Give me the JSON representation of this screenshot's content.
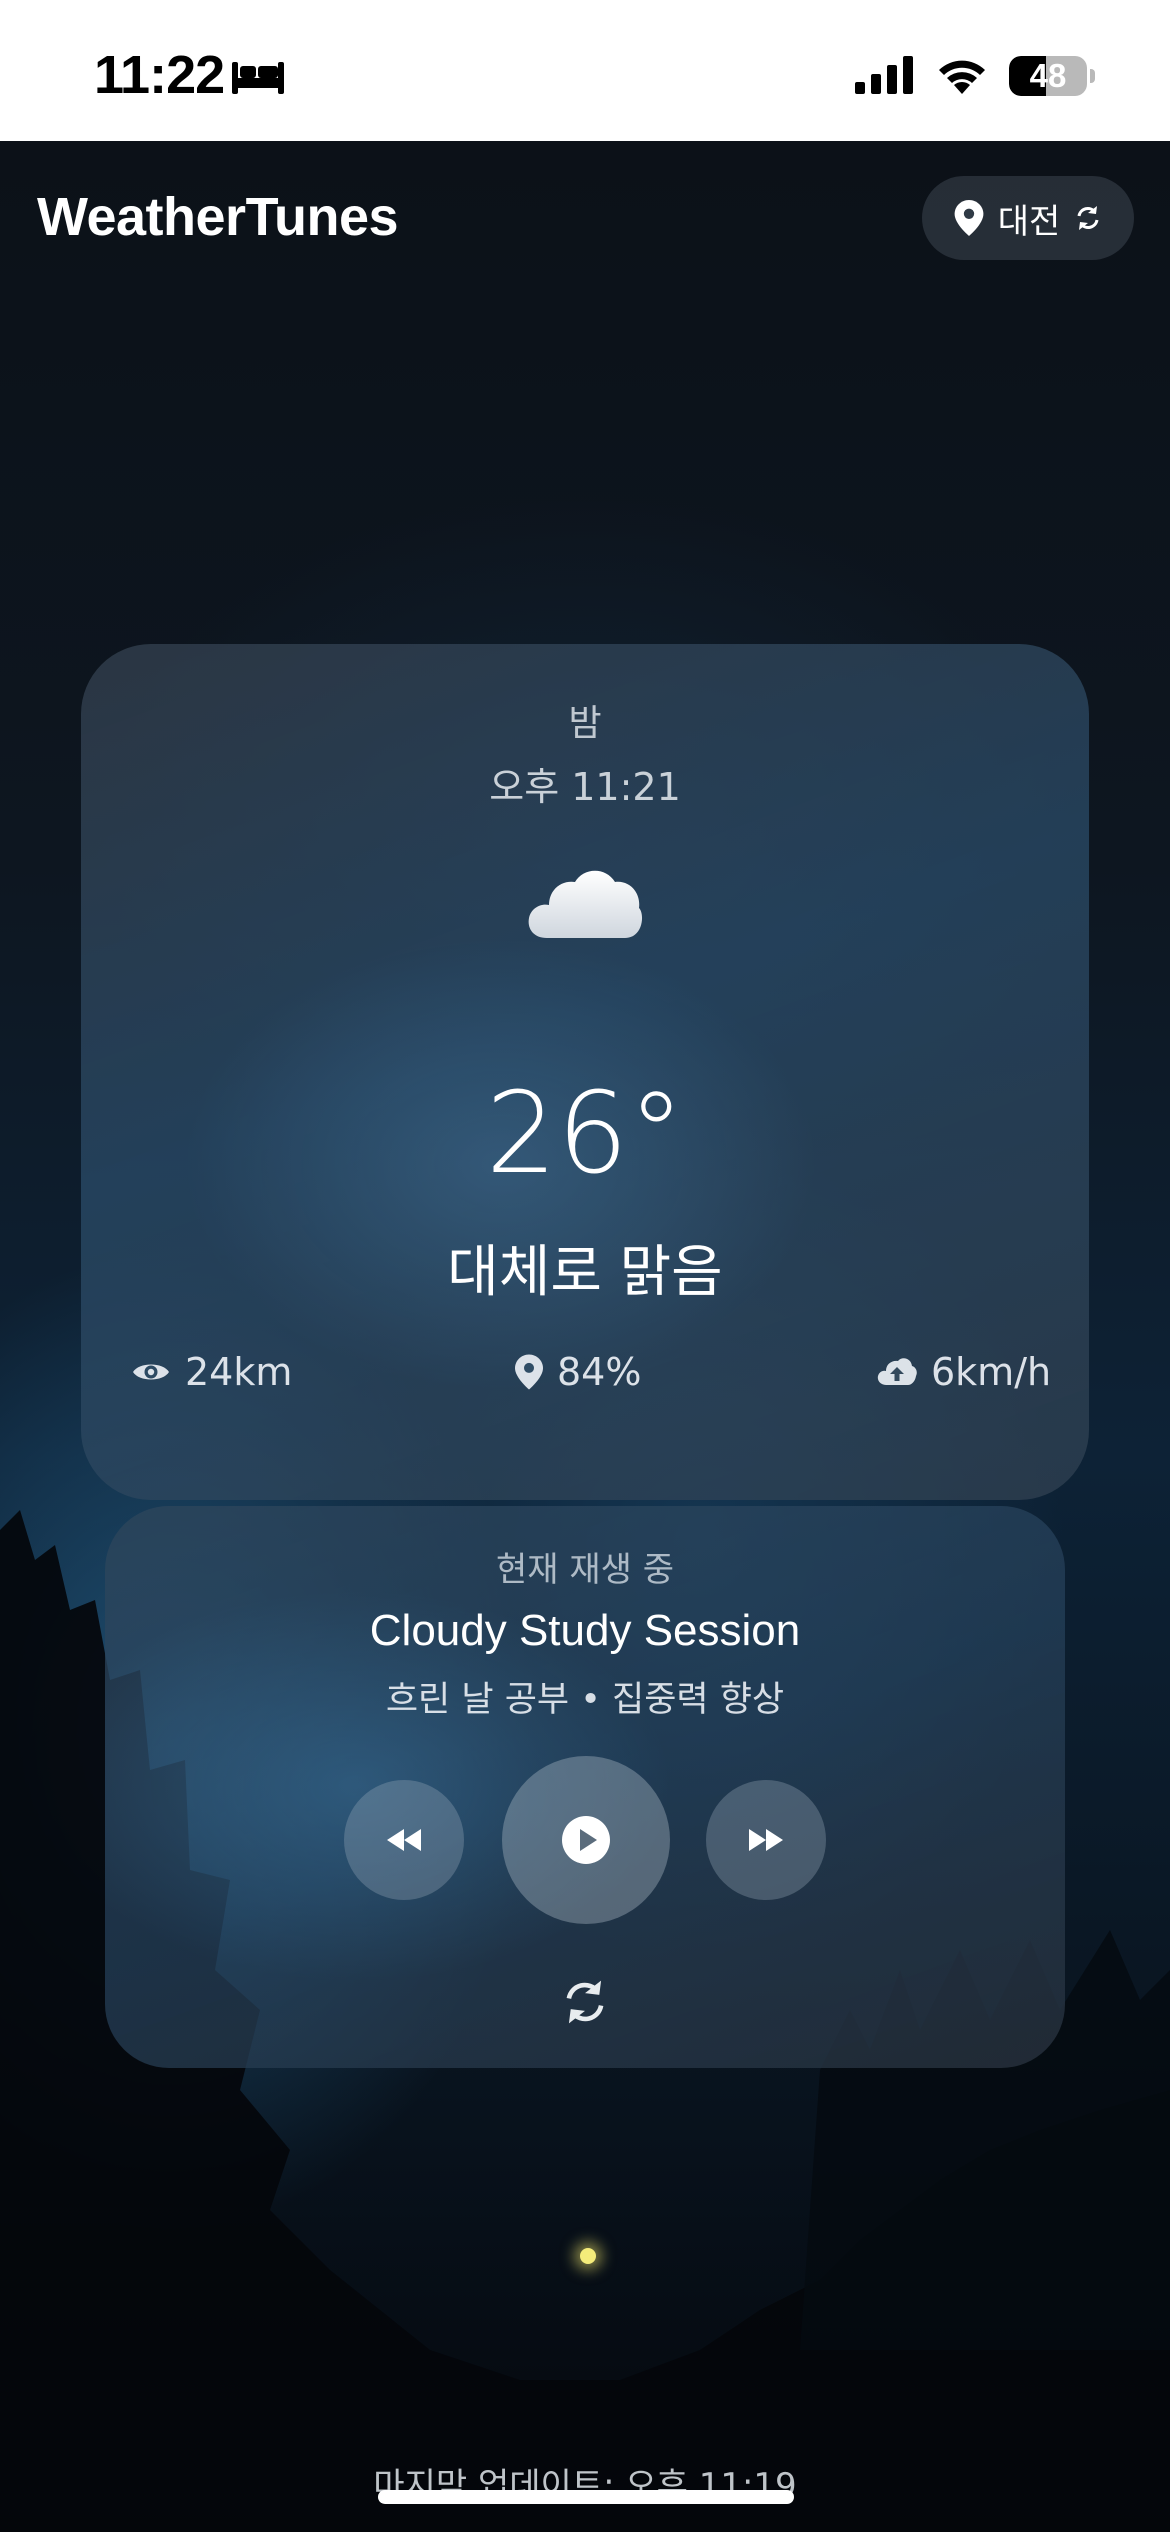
{
  "status_bar": {
    "time": "11:22",
    "battery_level": "48",
    "battery_fraction": 0.48
  },
  "header": {
    "app_title": "WeatherTunes",
    "location": "대전"
  },
  "weather": {
    "period": "밤",
    "time": "오후 11:21",
    "icon": "cloud-icon",
    "temperature": "26°",
    "description": "대체로 맑음",
    "visibility": "24km",
    "humidity": "84%",
    "wind": "6km/h"
  },
  "player": {
    "label": "현재 재생 중",
    "title": "Cloudy Study Session",
    "subtitle": "흐린 날 공부 • 집중력 향상"
  },
  "footer": {
    "last_update": "마지막 업데이트: 오후 11:19"
  },
  "colors": {
    "card_bg": "#3a4a5a",
    "accent_white": "#ffffff",
    "firefly": "#f4ec7a"
  }
}
